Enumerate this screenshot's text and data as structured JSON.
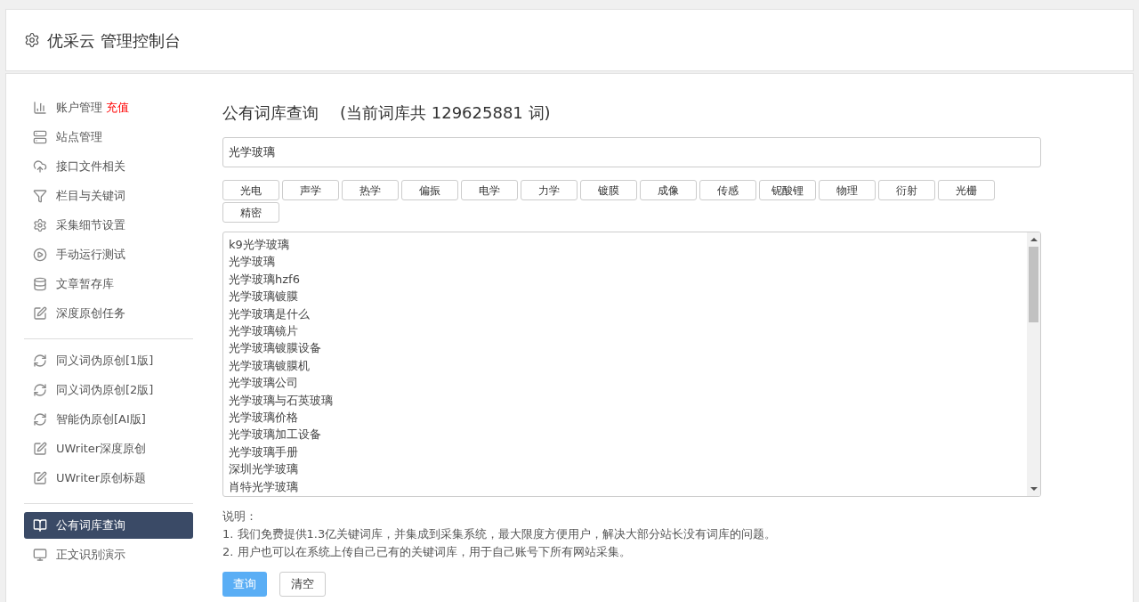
{
  "header": {
    "title": "优采云 管理控制台"
  },
  "sidebar": {
    "groups": [
      {
        "items": [
          {
            "label": "账户管理",
            "badge": "充值",
            "selected": false
          },
          {
            "label": "站点管理",
            "selected": false
          },
          {
            "label": "接口文件相关",
            "selected": false
          },
          {
            "label": "栏目与关键词",
            "selected": false
          },
          {
            "label": "采集细节设置",
            "selected": false
          },
          {
            "label": "手动运行测试",
            "selected": false
          },
          {
            "label": "文章暂存库",
            "selected": false
          },
          {
            "label": "深度原创任务",
            "selected": false
          }
        ]
      },
      {
        "items": [
          {
            "label": "同义词伪原创[1版]",
            "selected": false
          },
          {
            "label": "同义词伪原创[2版]",
            "selected": false
          },
          {
            "label": "智能伪原创[AI版]",
            "selected": false
          },
          {
            "label": "UWriter深度原创",
            "selected": false
          },
          {
            "label": "UWriter原创标题",
            "selected": false
          }
        ]
      },
      {
        "items": [
          {
            "label": "公有词库查询",
            "selected": true
          },
          {
            "label": "正文识别演示",
            "selected": false
          }
        ]
      }
    ]
  },
  "main": {
    "title": "公有词库查询",
    "count_text": "(当前词库共 129625881 词)",
    "search": {
      "value": "光学玻璃"
    },
    "tags": [
      "光电",
      "声学",
      "热学",
      "偏振",
      "电学",
      "力学",
      "镀膜",
      "成像",
      "传感",
      "铌酸锂",
      "物理",
      "衍射",
      "光栅",
      "精密"
    ],
    "results": [
      "k9光学玻璃",
      "光学玻璃",
      "光学玻璃hzf6",
      "光学玻璃镀膜",
      "光学玻璃是什么",
      "光学玻璃镜片",
      "光学玻璃镀膜设备",
      "光学玻璃镀膜机",
      "光学玻璃公司",
      "光学玻璃与石英玻璃",
      "光学玻璃价格",
      "光学玻璃加工设备",
      "光学玻璃手册",
      "深圳光学玻璃",
      "肖特光学玻璃"
    ],
    "notes_title": "说明：",
    "notes": [
      "1. 我们免费提供1.3亿关键词库，并集成到采集系统，最大限度方便用户，解决大部分站长没有词库的问题。",
      "2. 用户也可以在系统上传自己已有的关键词库，用于自己账号下所有网站采集。"
    ],
    "buttons": [
      {
        "label": "查询",
        "kind": "primary"
      },
      {
        "label": "清空",
        "kind": "default"
      }
    ]
  }
}
